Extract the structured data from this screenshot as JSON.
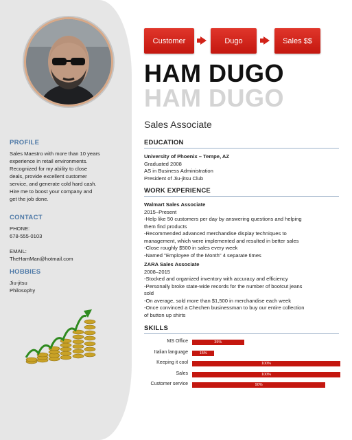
{
  "flow": [
    "Customer",
    "Dugo",
    "Sales $$"
  ],
  "name": "HAM DUGO",
  "job_title": "Sales Associate",
  "profile": {
    "title": "PROFILE",
    "lines": [
      "Sales Maestro with more than 10 years",
      "experience in retail environments.",
      "Recognized for my ability to close",
      "deals, provide excellent customer",
      "service, and generate cold hard cash.",
      "Hire me to boost your company and",
      "get the job done."
    ]
  },
  "contact": {
    "title": "CONTACT",
    "phone_label": "PHONE:",
    "phone": "678-555-0103",
    "email_label": "EMAIL:",
    "email": "TheHamMan@hotmail.com"
  },
  "hobbies": {
    "title": "HOBBIES",
    "items": [
      "Jiu-jitsu",
      "Philosophy"
    ]
  },
  "education": {
    "title": "EDUCATION",
    "school": "University of Phoenix – Tempe, AZ",
    "lines": [
      "Graduated 2008",
      "AS in Business Administration",
      "President of Jiu-jitsu Club"
    ]
  },
  "experience": {
    "title": "WORK EXPERIENCE",
    "jobs": [
      {
        "role": "Walmart Sales Associate",
        "dates": "2015–Present",
        "lines": [
          "-Help like 50 customers per day by answering questions and helping",
          "them find products",
          "-Recommended advanced merchandise display techniques to",
          "management, which were implemented and resulted in better sales",
          "-Close roughly $500 in sales every week",
          "-Named \"Employee of the Month\" 4 separate times"
        ]
      },
      {
        "role": "ZARA  Sales Associate",
        "dates": "2008–2015",
        "lines": [
          "-Stocked and organized inventory with accuracy and efficiency",
          "-Personally broke state-wide records for the number of bootcut jeans",
          "sold",
          "-On average, sold more than $1,500 in merchandise each week",
          "-Once convinced a Chechen businessman to buy our entire collection",
          "of button up shirts"
        ]
      }
    ]
  },
  "skills": {
    "title": "SKILLS",
    "items": [
      {
        "label": "MS Office",
        "percent": 35,
        "text": "35%"
      },
      {
        "label": "Italian language",
        "percent": 15,
        "text": "15%"
      },
      {
        "label": "Keeping it cool",
        "percent": 100,
        "text": "100%"
      },
      {
        "label": "Sales",
        "percent": 100,
        "text": "100%"
      },
      {
        "label": "Customer service",
        "percent": 90,
        "text": "90%"
      }
    ]
  },
  "colors": {
    "accent": "#c4170f",
    "heading_blue": "#4e79a7",
    "sidebar": "#e6e6e6"
  },
  "icons": [
    "profile-photo",
    "money-growth-illustration"
  ]
}
